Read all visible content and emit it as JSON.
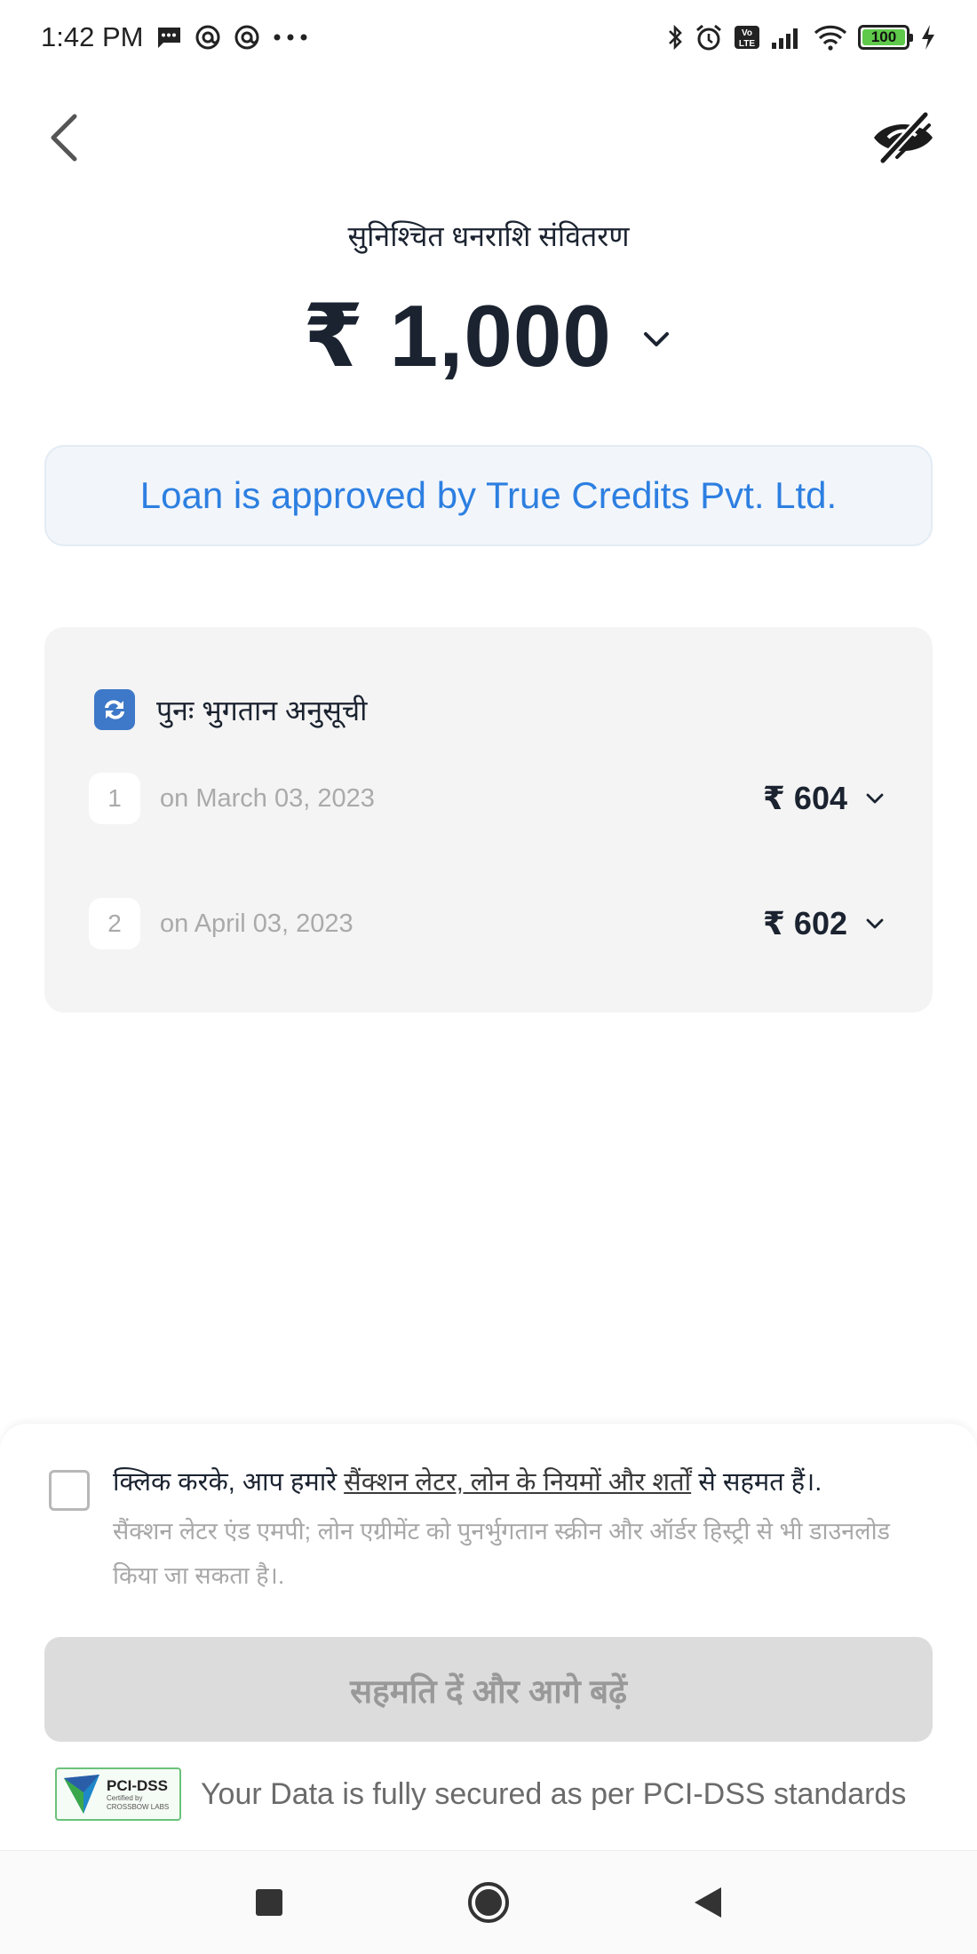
{
  "status_bar": {
    "time": "1:42 PM",
    "battery": "100",
    "icons": [
      "message-icon",
      "at-icon",
      "at-icon",
      "more-dots-icon",
      "bluetooth-icon",
      "alarm-icon",
      "volte-icon",
      "signal-icon",
      "wifi-icon",
      "battery-icon",
      "charging-icon"
    ]
  },
  "header": {
    "back_icon": "chevron-left-icon",
    "hide_icon": "eye-off-icon"
  },
  "amount": {
    "label": "सुनिश्चित धनराशि संवितरण",
    "value": "₹ 1,000"
  },
  "approval": {
    "text": "Loan is approved by True Credits Pvt. Ltd."
  },
  "schedule": {
    "title": "पुनः भुगतान अनुसूची",
    "installments": [
      {
        "number": "1",
        "date": "on March 03, 2023",
        "amount": "₹ 604"
      },
      {
        "number": "2",
        "date": "on April 03, 2023",
        "amount": "₹ 602"
      }
    ]
  },
  "consent": {
    "prefix": "क्लिक करके, आप हमारे ",
    "link": "सैंक्शन लेटर, लोन के नियमों और शर्तों",
    "suffix": " से सहमत हैं।.",
    "note": "सैंक्शन लेटर एंड एमपी; लोन एग्रीमेंट को पुनर्भुगतान स्क्रीन और ऑर्डर हिस्ट्री से भी डाउनलोड किया जा सकता है।."
  },
  "cta": {
    "label": "सहमति दें और आगे बढ़ें"
  },
  "security": {
    "badge_title": "PCI-DSS",
    "badge_sub1": "Certified by",
    "badge_sub2": "CROSSBOW LABS",
    "text": "Your Data is fully secured as per PCI-DSS standards"
  },
  "colors": {
    "accent_blue": "#2d7fe1",
    "text_dark": "#1b2330",
    "muted": "#aaaaaa",
    "disabled_button": "#dcdcdc"
  }
}
